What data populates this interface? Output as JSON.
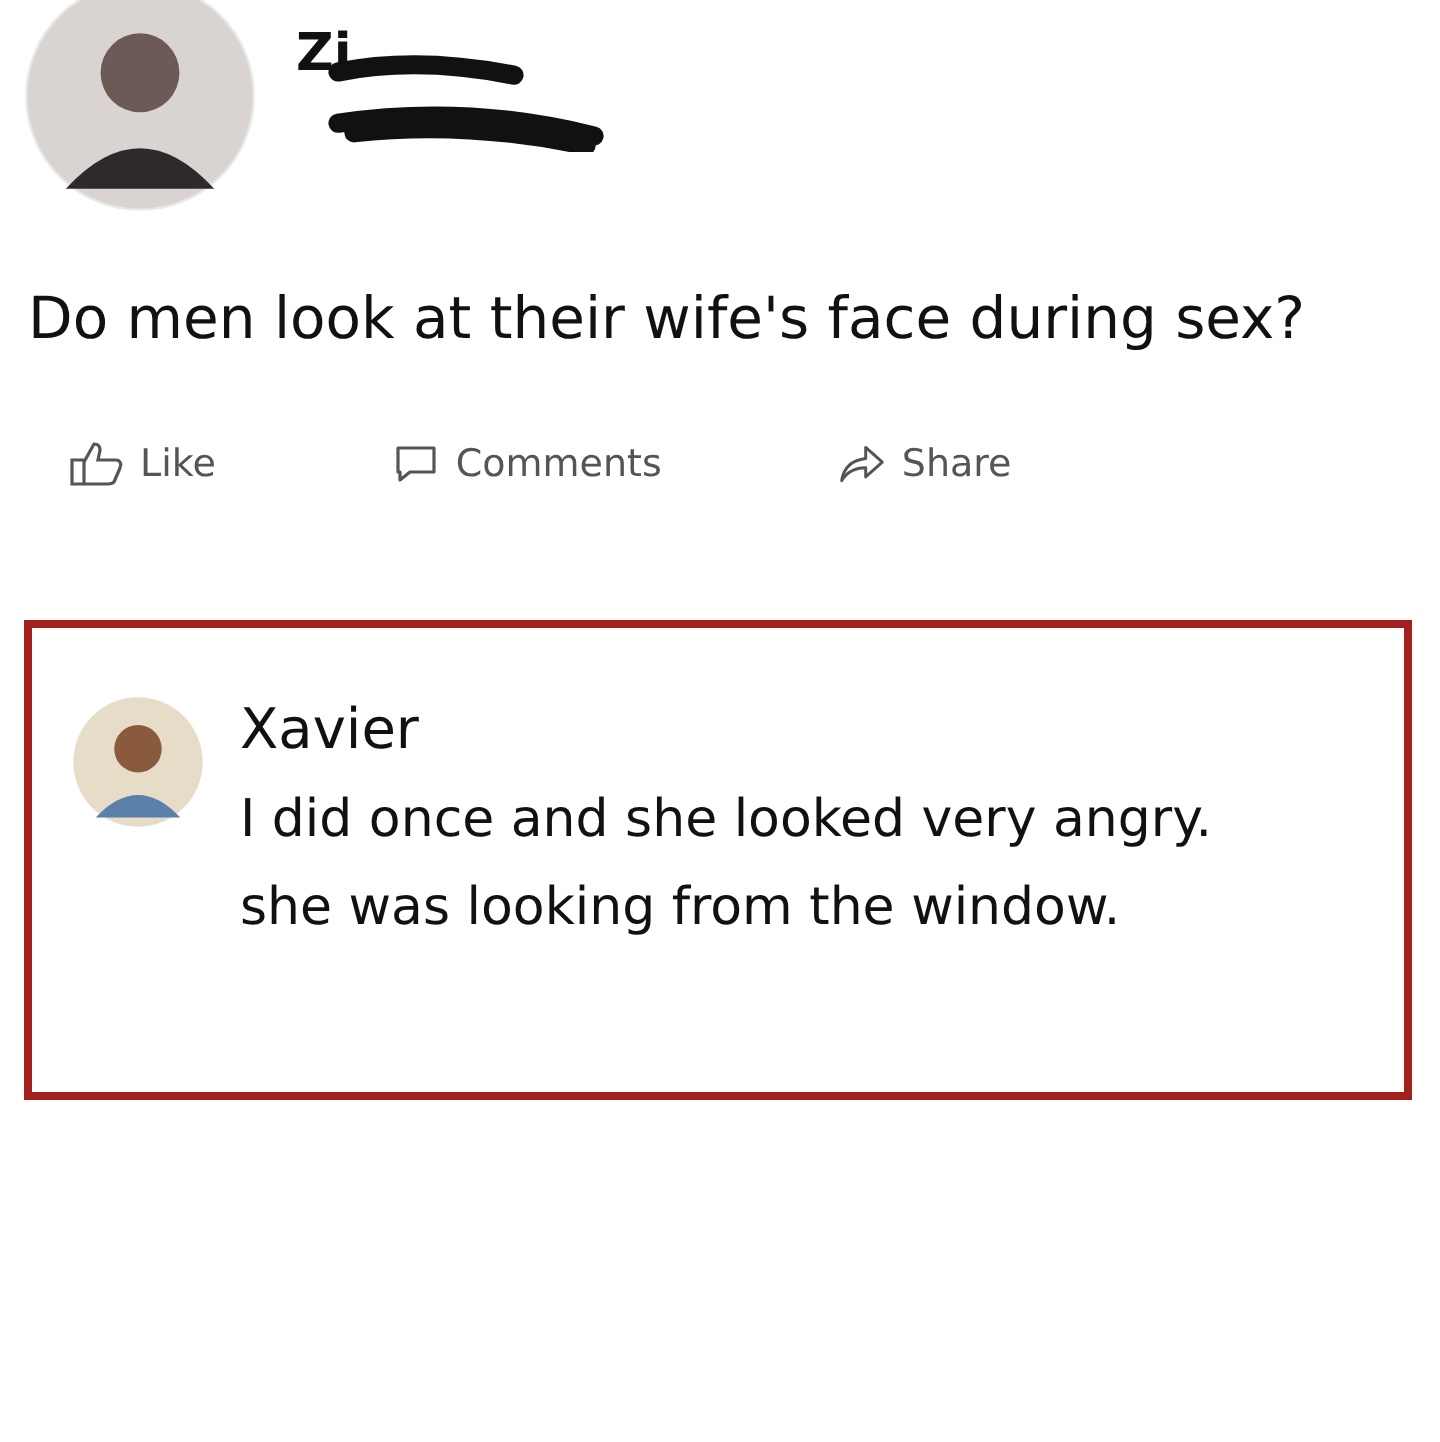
{
  "post": {
    "author": {
      "name": "Zi"
    },
    "text": "Do men look at their wife's face during sex?",
    "actions": [
      {
        "kind": "like",
        "label": "Like"
      },
      {
        "kind": "comment",
        "label": "Comments"
      },
      {
        "kind": "share",
        "label": "Share"
      }
    ]
  },
  "comment": {
    "author": "Xavier",
    "highlighted": true,
    "lines": [
      "I did once and she looked very angry.",
      "she was looking from the window."
    ]
  }
}
